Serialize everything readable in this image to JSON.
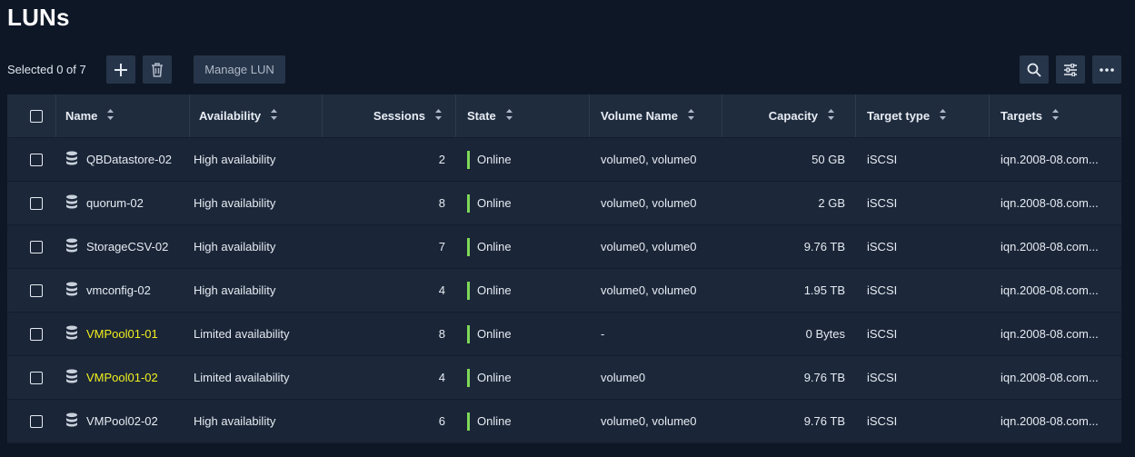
{
  "page": {
    "title": "LUNs"
  },
  "toolbar": {
    "selected_label": "Selected 0 of 7",
    "add_icon": "plus-icon",
    "delete_icon": "trash-icon",
    "manage_label": "Manage LUN",
    "search_icon": "search-icon",
    "filter_icon": "sliders-icon",
    "more_icon": "ellipsis-icon"
  },
  "colors": {
    "online": "#7ed957",
    "highlight": "#f3f01e",
    "background": "#0e1726"
  },
  "table": {
    "columns": [
      "Name",
      "Availability",
      "Sessions",
      "State",
      "Volume Name",
      "Capacity",
      "Target type",
      "Targets"
    ],
    "rows": [
      {
        "name": "QBDatastore-02",
        "availability": "High availability",
        "sessions": "2",
        "state": "Online",
        "volume": "volume0, volume0",
        "capacity": "50 GB",
        "target_type": "iSCSI",
        "targets": "iqn.2008-08.com..."
      },
      {
        "name": "quorum-02",
        "availability": "High availability",
        "sessions": "8",
        "state": "Online",
        "volume": "volume0, volume0",
        "capacity": "2 GB",
        "target_type": "iSCSI",
        "targets": "iqn.2008-08.com..."
      },
      {
        "name": "StorageCSV-02",
        "availability": "High availability",
        "sessions": "7",
        "state": "Online",
        "volume": "volume0, volume0",
        "capacity": "9.76 TB",
        "target_type": "iSCSI",
        "targets": "iqn.2008-08.com..."
      },
      {
        "name": "vmconfig-02",
        "availability": "High availability",
        "sessions": "4",
        "state": "Online",
        "volume": "volume0, volume0",
        "capacity": "1.95 TB",
        "target_type": "iSCSI",
        "targets": "iqn.2008-08.com..."
      },
      {
        "name": "VMPool01-01",
        "availability": "Limited availability",
        "sessions": "8",
        "state": "Online",
        "volume": "-",
        "capacity": "0 Bytes",
        "target_type": "iSCSI",
        "targets": "iqn.2008-08.com..."
      },
      {
        "name": "VMPool01-02",
        "availability": "Limited availability",
        "sessions": "4",
        "state": "Online",
        "volume": "volume0",
        "capacity": "9.76 TB",
        "target_type": "iSCSI",
        "targets": "iqn.2008-08.com..."
      },
      {
        "name": "VMPool02-02",
        "availability": "High availability",
        "sessions": "6",
        "state": "Online",
        "volume": "volume0, volume0",
        "capacity": "9.76 TB",
        "target_type": "iSCSI",
        "targets": "iqn.2008-08.com..."
      }
    ]
  }
}
